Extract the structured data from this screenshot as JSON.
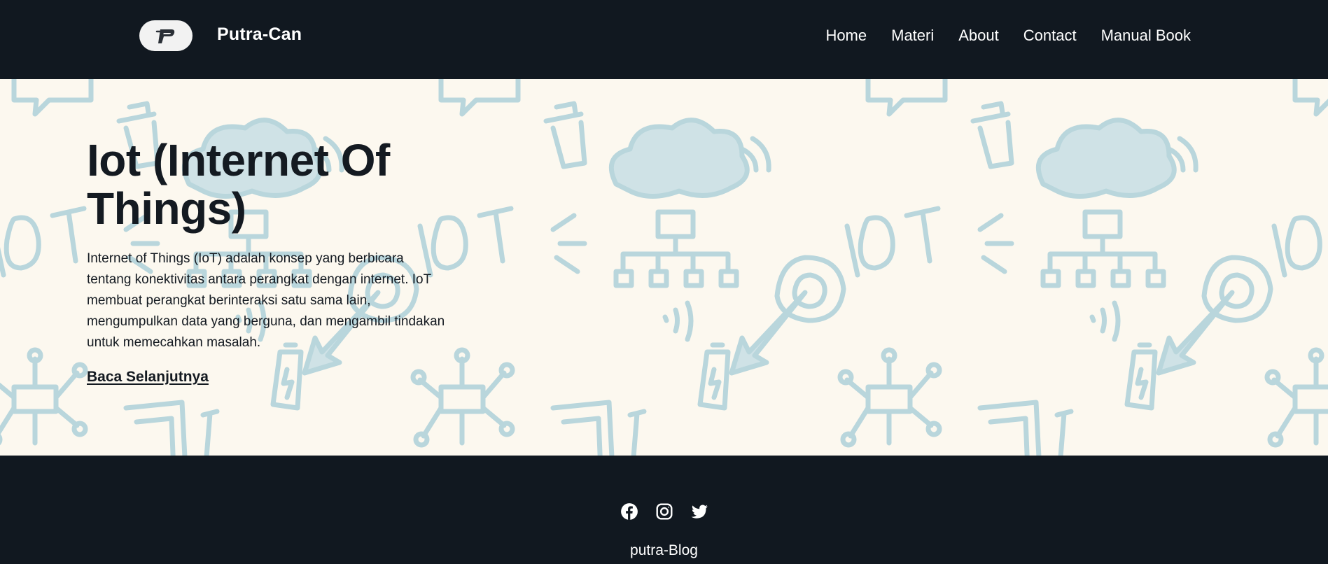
{
  "header": {
    "brand": "Putra-Can",
    "logo_icon": "p-logo-icon",
    "nav": [
      {
        "label": "Home"
      },
      {
        "label": "Materi"
      },
      {
        "label": "About"
      },
      {
        "label": "Contact"
      },
      {
        "label": "Manual Book"
      }
    ]
  },
  "hero": {
    "title": "Iot (Internet Of Things)",
    "paragraph": "Internet of Things (IoT) adalah konsep yang berbicara tentang konektivitas antara perangkat dengan internet. IoT membuat perangkat berinteraksi satu sama lain, mengumpulkan data yang berguna, dan mengambil tindakan untuk memecahkan masalah.",
    "link_label": "Baca Selanjutnya",
    "background_pattern": "iot-doodle-pattern"
  },
  "footer": {
    "socials": [
      {
        "icon": "facebook-icon"
      },
      {
        "icon": "instagram-icon"
      },
      {
        "icon": "twitter-icon"
      }
    ],
    "text": "putra-Blog"
  },
  "colors": {
    "dark": "#111820",
    "hero_bg": "#fcf8ef",
    "doodle": "#b9d6dc",
    "text": "#141a21"
  }
}
